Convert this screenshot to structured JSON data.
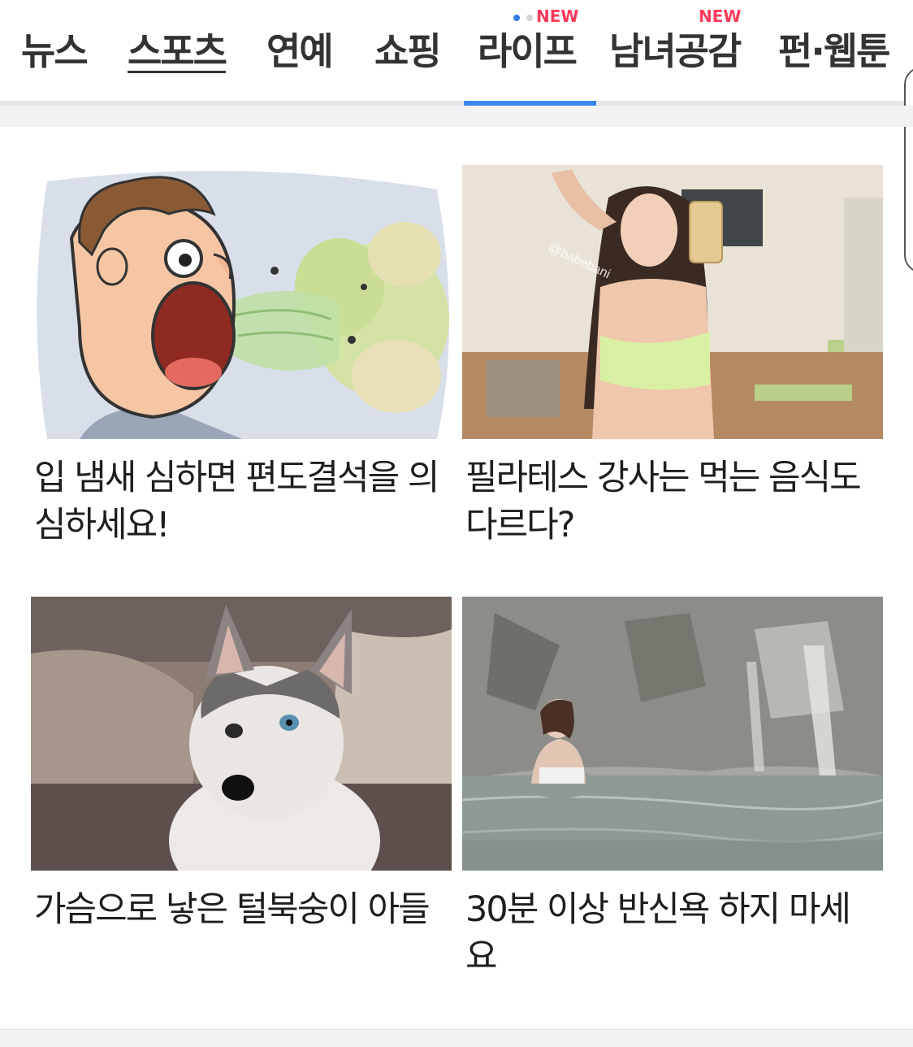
{
  "tabs": [
    {
      "label": "뉴스",
      "active": false
    },
    {
      "label": "스포츠",
      "active": false
    },
    {
      "label": "연예",
      "active": false
    },
    {
      "label": "쇼핑",
      "active": false
    },
    {
      "label": "라이프",
      "active": true
    },
    {
      "label": "남녀공감",
      "active": false
    },
    {
      "label": "펀·웹툰",
      "active": false
    }
  ],
  "badges": {
    "life_new": "NEW",
    "couple_new": "NEW"
  },
  "colors": {
    "accent": "#3b86ee",
    "badge": "#ff3b5c"
  },
  "articles": [
    {
      "title": "입 냄새 심하면 편도결석을 의심하세요!",
      "image": "bad-breath-cartoon"
    },
    {
      "title": "필라테스 강사는 먹는 음식도 다르다?",
      "image": "pilates-instructor-selfie",
      "watermark": "@babebani"
    },
    {
      "title": "가슴으로 낳은 털북숭이 아들",
      "image": "husky-puppy"
    },
    {
      "title": "30분 이상 반신욕 하지 마세요",
      "image": "woman-in-hot-spring"
    }
  ]
}
